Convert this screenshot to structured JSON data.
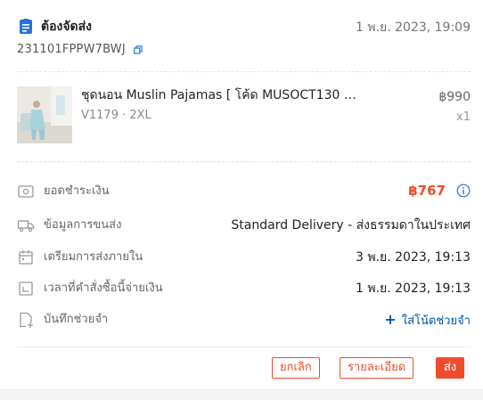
{
  "header": {
    "status": "ต้องจัดส่ง",
    "time": "1 พ.ย. 2023, 19:09",
    "order_id": "231101FPPW7BWJ"
  },
  "product": {
    "name": "ชุดนอน Muslin Pajamas [ โค้ด MUSOCT130 ลด 130 ...",
    "variant": "V1179 · 2XL",
    "price": "฿990",
    "qty": "x1"
  },
  "details": {
    "amount_label": "ยอดชำระเงิน",
    "amount_value": "฿767",
    "shipping_label": "ข้อมูลการขนส่ง",
    "shipping_value": "Standard Delivery - ส่งธรรมดาในประเทศ",
    "prepare_label": "เตรียมการส่งภายใน",
    "prepare_value": "3 พ.ย. 2023, 19:13",
    "paid_label": "เวลาที่คำสั่งซื้อนี้จ่ายเงิน",
    "paid_value": "1 พ.ย. 2023, 19:13",
    "note_label": "บันทึกช่วยจำ",
    "note_action": "ใส่โน้ตช่วยจำ"
  },
  "actions": {
    "cancel": "ยกเลิก",
    "details": "รายละเอียด",
    "ship": "ส่ง"
  },
  "colors": {
    "accent": "#ee4d2d",
    "link": "#0055aa",
    "status_icon": "#2673dd"
  },
  "icons": [
    "order-doc-icon",
    "copy-icon",
    "payment-icon",
    "truck-icon",
    "calendar-icon",
    "clock-icon",
    "note-icon",
    "info-icon",
    "plus-icon"
  ]
}
